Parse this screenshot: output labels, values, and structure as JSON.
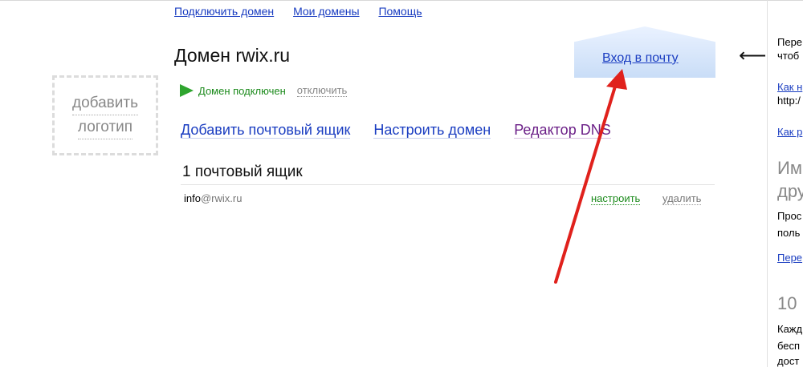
{
  "topnav": {
    "connect_domain": "Подключить домен",
    "my_domains": "Мои домены",
    "help": "Помощь"
  },
  "logo": {
    "line1": "добавить",
    "line2": "логотип"
  },
  "domain": {
    "title": "Домен rwix.ru",
    "status": "Домен подключен",
    "disable": "отключить"
  },
  "actions": {
    "add_mailbox": "Добавить почтовый ящик",
    "configure_domain": "Настроить домен",
    "dns_editor": "Редактор DNS"
  },
  "mailboxes": {
    "heading": "1 почтовый ящик",
    "rows": [
      {
        "local": "info",
        "domain": "@rwix.ru",
        "configure": "настроить",
        "delete": "удалить"
      }
    ]
  },
  "mail_login": {
    "label": "Вход в почту"
  },
  "sidebar": {
    "arrow": "⟵",
    "line1": "Пере",
    "line2": "чтоб",
    "link1": "Как н",
    "line3": "http:/",
    "link2": "Как р",
    "big1": "Им",
    "big2": "дру",
    "line4": "Прос",
    "line5": "поль",
    "link3": "Пере",
    "big3": "10",
    "line6": "Кажд",
    "line7": "бесп",
    "line8": "дост"
  },
  "colors": {
    "link": "#1a3dc1",
    "visited": "#6b1f87",
    "success": "#1b8a1b",
    "annotation_arrow": "#e0211c"
  }
}
